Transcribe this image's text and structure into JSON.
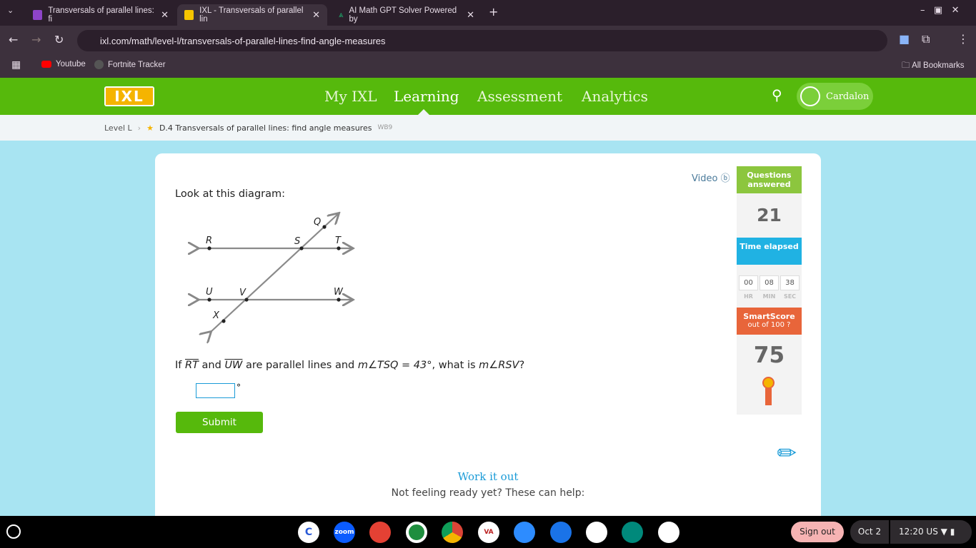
{
  "browser": {
    "tabs": [
      {
        "title": "Transversals of parallel lines: fi",
        "favicon_color": "#8e44c9"
      },
      {
        "title": "IXL - Transversals of parallel lin",
        "favicon_color": "#f5c400",
        "active": true
      },
      {
        "title": "AI Math GPT Solver Powered by",
        "favicon_color": "#1faa6b"
      }
    ],
    "url": "ixl.com/math/level-l/transversals-of-parallel-lines-find-angle-measures",
    "bookmarks": [
      "Youtube",
      "Fortnite Tracker"
    ],
    "all_bookmarks": "All Bookmarks"
  },
  "nav": {
    "logo": "IXL",
    "links": [
      "My IXL",
      "Learning",
      "Assessment",
      "Analytics"
    ],
    "active": "Learning",
    "user": "Cardalon"
  },
  "breadcrumb": {
    "level": "Level L",
    "skill": "D.4 Transversals of parallel lines: find angle measures",
    "code": "WB9"
  },
  "question": {
    "video": "Video",
    "prompt": "Look at this diagram:",
    "labels": {
      "Q": "Q",
      "R": "R",
      "S": "S",
      "T": "T",
      "U": "U",
      "V": "V",
      "W": "W",
      "X": "X"
    },
    "text_if": "If",
    "line1": "RT",
    "text_and": "and",
    "line2": "UW",
    "text_mid": "are parallel lines and",
    "given": "m∠TSQ = 43°",
    "text_what": ", what is",
    "ask": "m∠RSV",
    "text_end": "?",
    "answer_value": "",
    "degree": "°",
    "submit": "Submit"
  },
  "stats": {
    "questions_label": "Questions answered",
    "questions": "21",
    "time_label": "Time elapsed",
    "hr": "00",
    "min": "08",
    "sec": "38",
    "hr_l": "HR",
    "min_l": "MIN",
    "sec_l": "SEC",
    "smartscore_label": "SmartScore",
    "smartscore_sub": "out of 100",
    "smartscore": "75"
  },
  "help": {
    "title": "Work it out",
    "subtitle": "Not feeling ready yet? These can help:"
  },
  "taskbar": {
    "apps": [
      "C",
      "zoom",
      "",
      "",
      "",
      "VA",
      "",
      "",
      "",
      "",
      ""
    ],
    "sign_out": "Sign out",
    "date": "Oct 2",
    "time": "12:20",
    "locale": "US"
  }
}
